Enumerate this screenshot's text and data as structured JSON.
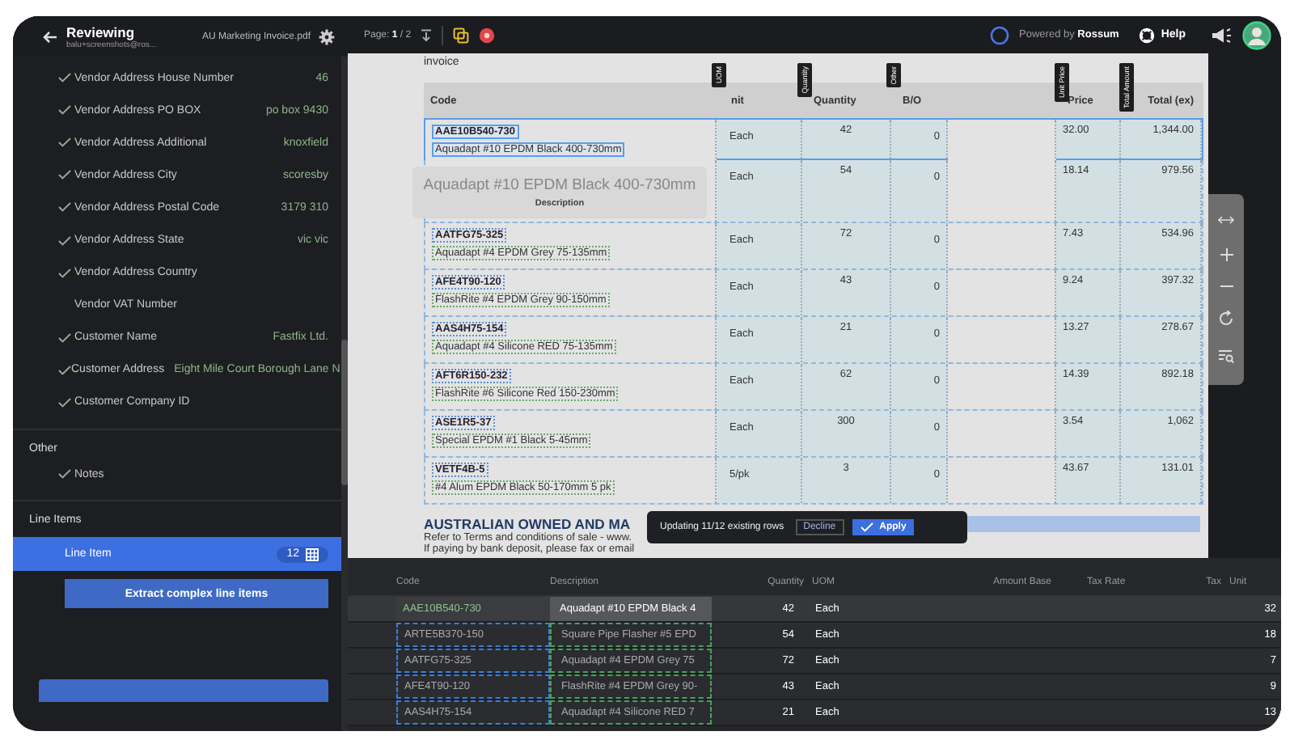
{
  "sidebar": {
    "title": "Reviewing",
    "subtitle": "balu+screenshots@ros...",
    "file": "AU Marketing Invoice.pdf",
    "fields": [
      {
        "label": "Vendor Address House Number",
        "value": "46",
        "checked": true
      },
      {
        "label": "Vendor Address PO BOX",
        "value": "po box 9430",
        "checked": true
      },
      {
        "label": "Vendor Address Additional",
        "value": "knoxfield",
        "checked": true
      },
      {
        "label": "Vendor Address City",
        "value": "scoresby",
        "checked": true
      },
      {
        "label": "Vendor Address Postal Code",
        "value": "3179 310",
        "checked": true
      },
      {
        "label": "Vendor Address State",
        "value": "vic vic",
        "checked": true
      },
      {
        "label": "Vendor Address Country",
        "checked": true
      },
      {
        "label": "Vendor VAT Number",
        "checked": false
      },
      {
        "label": "Customer Name",
        "value": "Fastfix Ltd.",
        "checked": true
      },
      {
        "label": "Customer Address",
        "value": "Eight Mile Court Borough Lane N",
        "checked": true
      },
      {
        "label": "Customer Company ID",
        "checked": true
      }
    ],
    "other": {
      "title": "Other",
      "fields": [
        {
          "label": "Notes",
          "checked": true
        }
      ]
    },
    "line_items": {
      "title": "Line Items",
      "item": {
        "label": "Line Item",
        "count": "12",
        "selected": true
      },
      "extract": "Extract complex line items"
    }
  },
  "topbar": {
    "page": "Page: **1** / 2",
    "powered": "Powered by **Rossum**",
    "help": "Help"
  },
  "document": {
    "caption": "invoice",
    "columns": [
      {
        "label": "Code"
      },
      {
        "label": "nit",
        "tag": "UOM"
      },
      {
        "label": "Quantity",
        "tag": "Quantity"
      },
      {
        "label": "B/O",
        "tag": "Other"
      },
      {},
      {
        "label": "Price",
        "tag": "Unit Price"
      },
      {
        "label": "Total (ex)",
        "tag": "Total Amount"
      }
    ],
    "rows": [
      {
        "code": "AAE10B540-730",
        "description": "Aquadapt #10 EPDM Black 400-730mm",
        "unit": "Each",
        "quantity": "42",
        "bo": "0",
        "price": "32.00",
        "total": "1,344.00",
        "selected": true
      },
      {
        "unit": "Each",
        "quantity": "54",
        "bo": "0",
        "price": "18.14",
        "total": "979.56",
        "selected": false
      },
      {
        "code": "AATFG75-325",
        "description": "Aquadapt #4 EPDM Grey 75-135mm",
        "unit": "Each",
        "quantity": "72",
        "bo": "0",
        "price": "7.43",
        "total": "534.96",
        "selected": false
      },
      {
        "code": "AFE4T90-120",
        "description": "FlashRite #4 EPDM Grey 90-150mm",
        "unit": "Each",
        "quantity": "43",
        "bo": "0",
        "price": "9.24",
        "total": "397.32",
        "selected": false
      },
      {
        "code": "AAS4H75-154",
        "description": "Aquadapt #4 Silicone RED 75-135mm",
        "unit": "Each",
        "quantity": "21",
        "bo": "0",
        "price": "13.27",
        "total": "278.67",
        "selected": false
      },
      {
        "code": "AFT6R150-232",
        "description": "FlashRite #6 Silicone Red 150-230mm",
        "unit": "Each",
        "quantity": "62",
        "bo": "0",
        "price": "14.39",
        "total": "892.18",
        "selected": false
      },
      {
        "code": "ASE1R5-37",
        "description": "Special EPDM #1 Black 5-45mm",
        "unit": "Each",
        "quantity": "300",
        "bo": "0",
        "price": "3.54",
        "total": "1,062",
        "selected": false
      },
      {
        "code": "VETF4B-5",
        "description": "#4 Alum EPDM Black 50-170mm 5 pk",
        "unit": "5/pk",
        "quantity": "3",
        "bo": "0",
        "price": "43.67",
        "total": "131.01",
        "selected": false
      }
    ],
    "heading": "AUSTRALIAN OWNED AND MA",
    "notes": [
      "Refer to Terms and conditions of sale - www.",
      "If paying by bank deposit, please fax or email"
    ]
  },
  "tooltip": {
    "text": "Aquadapt #10 EPDM Black 400-730mm",
    "label": "Description"
  },
  "toast": {
    "message": "Updating 11/12 existing rows",
    "decline": "Decline",
    "apply": "Apply"
  },
  "grid": {
    "columns": [
      "Code",
      "Description",
      "Quantity",
      "UOM",
      "Amount Base",
      "Tax Rate",
      "Tax",
      "Unit"
    ],
    "rows": [
      {
        "code": "AAE10B540-730",
        "description": "Aquadapt #10 EPDM Black 4",
        "quantity": "42",
        "uom": "Each",
        "unit": "32",
        "selected": true
      },
      {
        "code": "ARTE5B370-150",
        "description": "Square Pipe Flasher #5 EPD",
        "quantity": "54",
        "uom": "Each",
        "unit": "18",
        "selected": false
      },
      {
        "code": "AATFG75-325",
        "description": "Aquadapt #4 EPDM Grey 75",
        "quantity": "72",
        "uom": "Each",
        "unit": "7",
        "selected": false
      },
      {
        "code": "AFE4T90-120",
        "description": "FlashRite #4 EPDM Grey 90-",
        "quantity": "43",
        "uom": "Each",
        "unit": "9",
        "selected": false
      },
      {
        "code": "AAS4H75-154",
        "description": "Aquadapt #4 Silicone RED 7",
        "quantity": "21",
        "uom": "Each",
        "unit": "13",
        "selected": false
      }
    ]
  }
}
